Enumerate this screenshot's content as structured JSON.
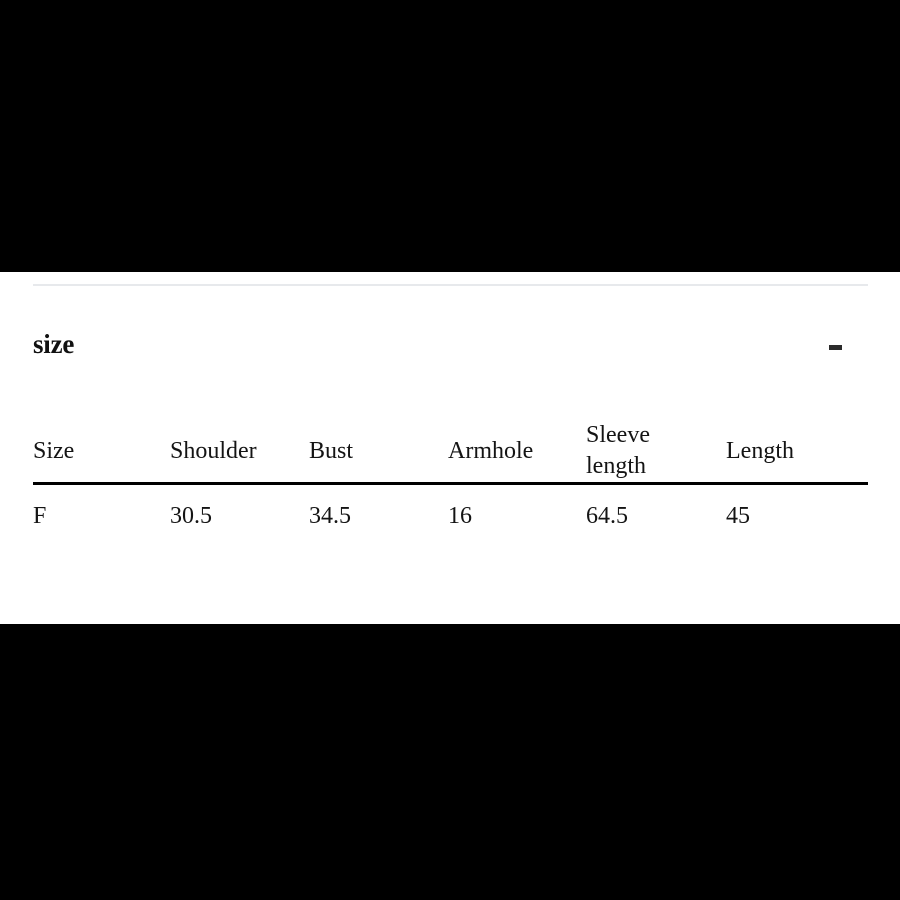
{
  "page": {
    "background_color": "#000000",
    "panel_background_color": "#ffffff",
    "text_color": "#141414"
  },
  "section": {
    "title": "size",
    "collapse_icon": "minus-icon",
    "collapse_label": "-"
  },
  "size_table": {
    "columns": [
      "Size",
      "Shoulder",
      "Bust",
      "Armhole",
      "Sleeve length",
      "Length"
    ],
    "rows": [
      {
        "size": "F",
        "shoulder": "30.5",
        "bust": "34.5",
        "armhole": "16",
        "sleeve_length": "64.5",
        "length": "45"
      }
    ]
  }
}
